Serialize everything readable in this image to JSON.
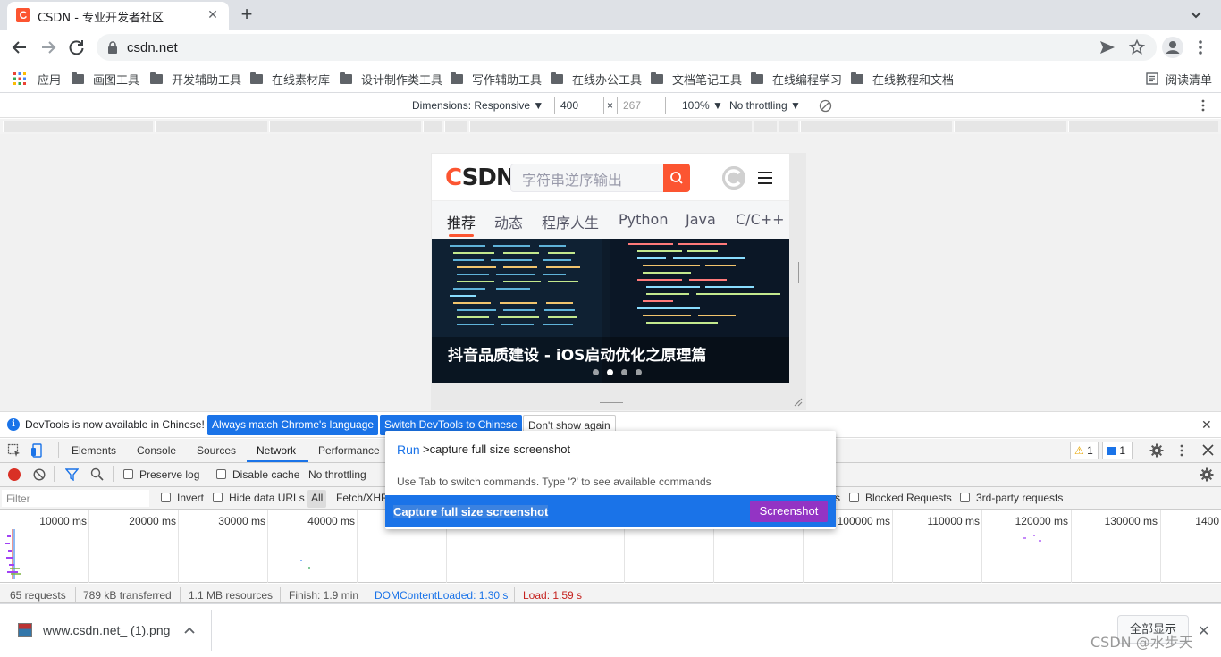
{
  "tab": {
    "title": "CSDN - 专业开发者社区",
    "favicon": "C",
    "close": "✕",
    "new_tab": "+"
  },
  "omnibox": {
    "url": "csdn.net"
  },
  "bookmarks": {
    "apps": "应用",
    "folders": [
      "画图工具",
      "开发辅助工具",
      "在线素材库",
      "设计制作类工具",
      "写作辅助工具",
      "在线办公工具",
      "文档笔记工具",
      "在线编程学习",
      "在线教程和文档"
    ],
    "reading_list": "阅读清单"
  },
  "device_toolbar": {
    "dimensions": "Dimensions: Responsive",
    "width": "400",
    "times": "×",
    "height_placeholder": "267",
    "zoom": "100%",
    "throttling": "No throttling"
  },
  "page": {
    "logo_c": "C",
    "logo_rest": "SDN",
    "search_placeholder": "字符串逆序输出",
    "nav": [
      "推荐",
      "动态",
      "程序人生",
      "Python",
      "Java",
      "C/C++"
    ],
    "banner_title": "抖音品质建设 - iOS启动优化之原理篇"
  },
  "infobar": {
    "message": "DevTools is now available in Chinese!",
    "btn_match": "Always match Chrome's language",
    "btn_switch": "Switch DevTools to Chinese",
    "btn_dismiss": "Don't show again",
    "close": "✕"
  },
  "devtools": {
    "tabs": [
      "Elements",
      "Console",
      "Sources",
      "Network",
      "Performance"
    ],
    "active_tab": "Network",
    "warnings": "1",
    "messages": "1",
    "preserve_log": "Preserve log",
    "disable_cache": "Disable cache",
    "throttling": "No throttling",
    "filter_placeholder": "Filter",
    "invert": "Invert",
    "hide_data_urls": "Hide data URLs",
    "all": "All",
    "fetch_xhr": "Fetch/XHR",
    "s_fragment": "s",
    "blocked_requests": "Blocked Requests",
    "third_party": "3rd-party requests",
    "timeline_labels": [
      "10000 ms",
      "20000 ms",
      "30000 ms",
      "40000 ms",
      "100000 ms",
      "110000 ms",
      "120000 ms",
      "130000 ms",
      "1400"
    ],
    "status": {
      "requests": "65 requests",
      "transferred": "789 kB transferred",
      "resources": "1.1 MB resources",
      "finish": "Finish: 1.9 min",
      "dom_loaded": "DOMContentLoaded: 1.30 s",
      "load": "Load: 1.59 s"
    }
  },
  "command_menu": {
    "prefix": "Run",
    "input": ">capture full size screenshot",
    "hint": "Use Tab to switch commands. Type '?' to see available commands",
    "item": "Capture full size screenshot",
    "item_category": "Screenshot"
  },
  "downloads": {
    "file": "www.csdn.net_ (1).png",
    "show_all": "全部显示",
    "close": "✕"
  },
  "watermark": "CSDN @水步天",
  "colors": {
    "csdn_red": "#fc5531",
    "chrome_blue": "#1a73e8",
    "screenshot_tag": "#9334c4"
  }
}
